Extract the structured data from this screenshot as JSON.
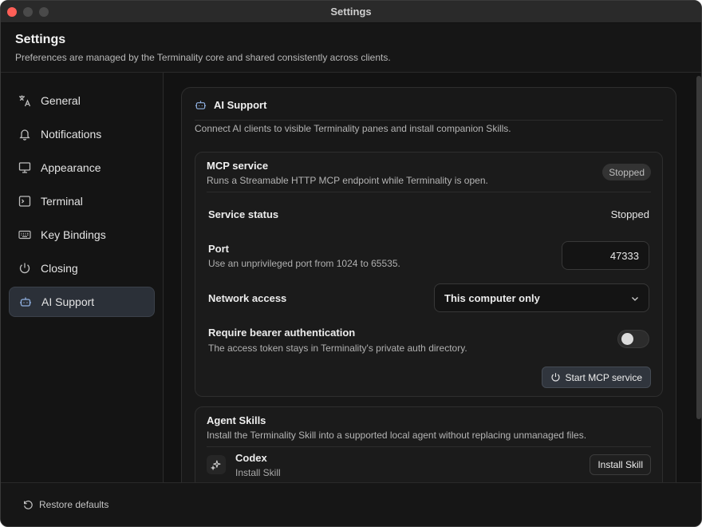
{
  "window": {
    "title": "Settings"
  },
  "header": {
    "title": "Settings",
    "subtitle": "Preferences are managed by the Terminality core and shared consistently across clients."
  },
  "sidebar": {
    "items": [
      {
        "label": "General",
        "icon": "translate-icon"
      },
      {
        "label": "Notifications",
        "icon": "bell-icon"
      },
      {
        "label": "Appearance",
        "icon": "monitor-icon"
      },
      {
        "label": "Terminal",
        "icon": "terminal-icon"
      },
      {
        "label": "Key Bindings",
        "icon": "keyboard-icon"
      },
      {
        "label": "Closing",
        "icon": "power-icon"
      },
      {
        "label": "AI Support",
        "icon": "robot-icon",
        "active": true
      }
    ]
  },
  "ai_support": {
    "title": "AI Support",
    "description": "Connect AI clients to visible Terminality panes and install companion Skills.",
    "mcp": {
      "title": "MCP service",
      "description": "Runs a Streamable HTTP MCP endpoint while Terminality is open.",
      "badge": "Stopped",
      "status_label": "Service status",
      "status_value": "Stopped",
      "port_label": "Port",
      "port_hint": "Use an unprivileged port from 1024 to 65535.",
      "port_value": "47333",
      "network_label": "Network access",
      "network_value": "This computer only",
      "auth_label": "Require bearer authentication",
      "auth_hint": "The access token stays in Terminality's private auth directory.",
      "auth_enabled": false,
      "start_button": "Start MCP service"
    },
    "skills": {
      "title": "Agent Skills",
      "description": "Install the Terminality Skill into a supported local agent without replacing unmanaged files.",
      "items": [
        {
          "name": "Codex",
          "subtitle": "Install Skill",
          "button": "Install Skill"
        }
      ]
    }
  },
  "footer": {
    "restore_label": "Restore defaults"
  },
  "colors": {
    "accent": "#2b3038",
    "close": "#ff5f57",
    "background": "#141414"
  }
}
